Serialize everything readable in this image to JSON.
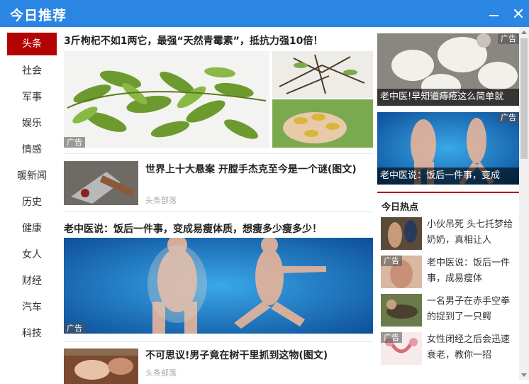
{
  "window": {
    "title": "今日推荐"
  },
  "sidebar": {
    "items": [
      {
        "label": "头条",
        "active": true
      },
      {
        "label": "社会"
      },
      {
        "label": "军事"
      },
      {
        "label": "娱乐"
      },
      {
        "label": "情感"
      },
      {
        "label": "暖新闻"
      },
      {
        "label": "历史"
      },
      {
        "label": "健康"
      },
      {
        "label": "女人"
      },
      {
        "label": "财经"
      },
      {
        "label": "汽车"
      },
      {
        "label": "科技"
      }
    ]
  },
  "feed": {
    "article1": {
      "title": "3斤枸杞不如1两它，最强“天然青霉素”，抵抗力强10倍！",
      "ad": "广告"
    },
    "article2": {
      "title": "世界上十大悬案 开膛手杰克至今是一个谜(图文)",
      "source": "头条部落"
    },
    "article3": {
      "title": "老中医说：饭后一件事，变成易瘦体质，想瘦多少瘦多少！",
      "ad": "广告"
    },
    "article4": {
      "title": "不可思议!男子竟在树干里抓到这物(图文)",
      "source": "头条部落"
    }
  },
  "right": {
    "ad1": {
      "ad": "广告",
      "caption": "老中医!早知道痔疮这么简单就"
    },
    "ad2": {
      "ad": "广告",
      "caption": "老中医说：饭后一件事，变成"
    },
    "hot_title": "今日热点",
    "hot": [
      {
        "text": "小伙吊死 头七托梦给奶奶，真相让人",
        "ad": ""
      },
      {
        "text": "老中医说：饭后一件事，成易瘦体",
        "ad": "广告"
      },
      {
        "text": "一名男子在赤手空拳的捉到了一只鳄",
        "ad": ""
      },
      {
        "text": "女性闭经之后会迅速衰老，教你一招",
        "ad": "广告"
      }
    ]
  }
}
